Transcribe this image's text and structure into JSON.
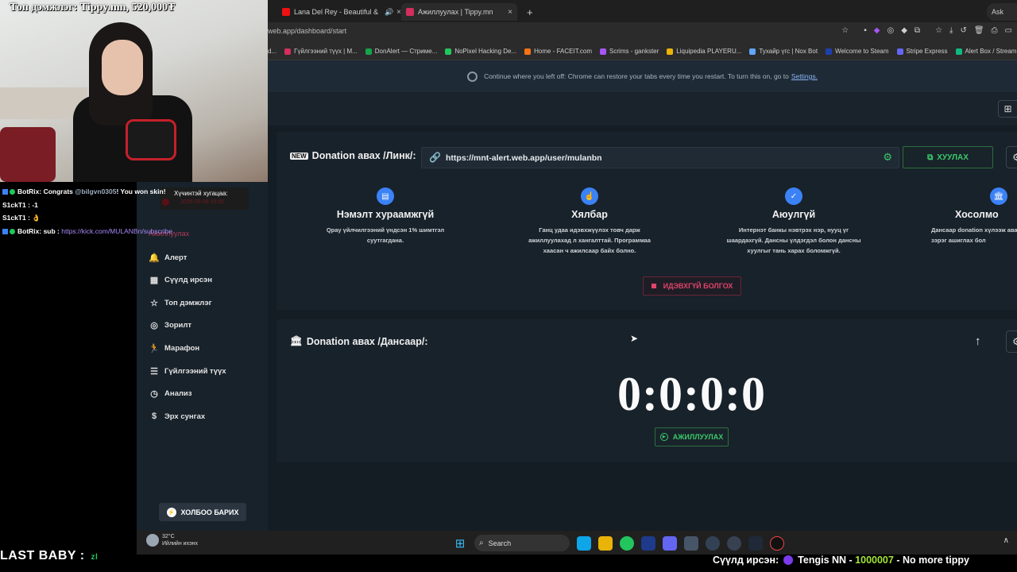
{
  "browser": {
    "tabs": [
      {
        "title": "Lana Del Rey - Beautiful &",
        "close": "×"
      },
      {
        "title": "Ажиллуулах | Tippy.mn",
        "close": "×"
      }
    ],
    "new_tab": "+",
    "url": "web.app/dashboard/start",
    "bookmarks": [
      "d...",
      "Гүйлгээний түүх | M...",
      "DonAlert — Стриме...",
      "NoPixel Hacking De...",
      "Home - FACEIT.com",
      "Scrims - gankster",
      "Liquipedia PLAYERU...",
      "Тухайр үгс | Nox Bot",
      "Welcome to Steam",
      "Stripe Express",
      "Alert Box / Streamla"
    ],
    "restore_msg": "Continue where you left off: Chrome can restore your tabs every time you restart. To turn this on, go to",
    "restore_link": "Settings.",
    "profile": "Ask"
  },
  "stream": {
    "top_donor": "Топ дэмжлэг: Tippy.mn, 520,000₮",
    "chat": [
      {
        "user": "BotRix",
        "text_pre": ": Congrats ",
        "mention": "@bilgvn0305",
        "text_post": "! You won skin!"
      },
      {
        "user": "S1ckT1",
        "text": ": -1"
      },
      {
        "user": "S1ckT1",
        "text": ": 👌"
      },
      {
        "user": "BotRix",
        "text_pre": ": sub : ",
        "link": "https://kick.com/MULANBn/subscribe"
      }
    ],
    "last_follower_label": "Хүчинтэй хугацаа:",
    "last_follower_value": "2026-05-08 19:55",
    "last_baby_label": "LAST BABY :",
    "last_baby_value": "zl",
    "ticker_label": "Сүүлд ирсэн:",
    "ticker_user": "Tengis NN",
    "ticker_amount": "1000007",
    "ticker_msg": "- No more tippy"
  },
  "sidebar": {
    "hidden_item": "Ажиллуулах",
    "items": [
      {
        "label": "Алерт",
        "icon": "bell-icon"
      },
      {
        "label": "Сүүлд ирсэн",
        "icon": "calendar-icon"
      },
      {
        "label": "Топ дэмжлэг",
        "icon": "star-icon"
      },
      {
        "label": "Зорилт",
        "icon": "target-icon"
      },
      {
        "label": "Марафон",
        "icon": "runner-icon"
      },
      {
        "label": "Гүйлгээний түүх",
        "icon": "list-icon"
      },
      {
        "label": "Анализ",
        "icon": "clock-icon"
      },
      {
        "label": "Эрх сунгах",
        "icon": "dollar-icon"
      }
    ],
    "contact_button": "ХОЛБОО БАРИХ"
  },
  "donation_link": {
    "title": "Donation авах /Линк/:",
    "url": "https://mnt-alert.web.app/user/mulanbn",
    "copy_button": "ХУУЛАХ",
    "features": [
      {
        "title": "Нэмэлт хураамжгүй",
        "desc": "Qpay үйлчилгээний үндсэн 1% шимтгэл суутгагдана."
      },
      {
        "title": "Хялбар",
        "desc": "Ганц удаа идэвхжүүлэх товч дарж ажиллуулахад л хангалттай. Программаа хаасан ч ажилсаар байх болно."
      },
      {
        "title": "Аюулгүй",
        "desc": "Интернэт банкы нэвтрэх нэр, нууц үг шаардахгүй. Дансны үлдэгдэл болон дансны хуулгыг тань харах боломжгүй."
      },
      {
        "title": "Хосолмо",
        "desc": "Дансаар donation хүлээж авах зэрэг ашиглах бол"
      }
    ],
    "disable_button": "ИДЭВХГҮЙ БОЛГОХ"
  },
  "donation_bank": {
    "title": "Donation авах /Дансаар/:",
    "timer": "0:0:0:0",
    "activate_button": "АЖИЛЛУУЛАХ"
  },
  "taskbar": {
    "temp": "32°C",
    "weather": "Ийлийн ихэнх",
    "search": "Search"
  },
  "colors": {
    "accent_green": "#3cc76a",
    "accent_red": "#e0446a",
    "accent_blue": "#3b82f6"
  }
}
